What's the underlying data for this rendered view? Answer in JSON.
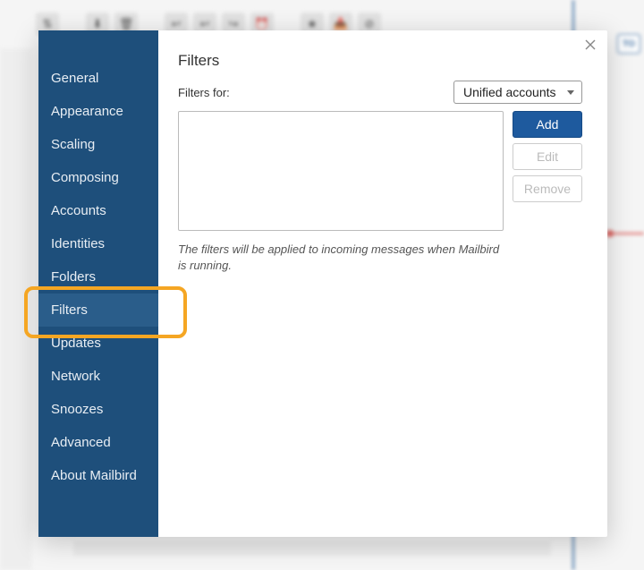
{
  "colors": {
    "sidebar_bg": "#1e4f7b",
    "sidebar_selected": "#2a5d8a",
    "primary_button": "#1e5a9e",
    "highlight": "#f5a623",
    "accent_line": "#2e639c",
    "now_indicator": "#d9534f"
  },
  "bg": {
    "today_label": "TO",
    "toolbar_icons": [
      "sort-icon",
      "download-icon",
      "delete-icon",
      "reply-icon",
      "reply-all-icon",
      "forward-icon",
      "snooze-icon",
      "star-icon",
      "archive-icon",
      "block-icon"
    ]
  },
  "modal": {
    "close_label": "Close",
    "sidebar": {
      "items": [
        {
          "label": "General"
        },
        {
          "label": "Appearance"
        },
        {
          "label": "Scaling"
        },
        {
          "label": "Composing"
        },
        {
          "label": "Accounts"
        },
        {
          "label": "Identities"
        },
        {
          "label": "Folders"
        },
        {
          "label": "Filters",
          "selected": true
        },
        {
          "label": "Updates"
        },
        {
          "label": "Network"
        },
        {
          "label": "Snoozes"
        },
        {
          "label": "Advanced"
        },
        {
          "label": "About Mailbird"
        }
      ]
    },
    "content": {
      "title": "Filters",
      "filters_for_label": "Filters for:",
      "account_selected": "Unified accounts",
      "buttons": {
        "add": "Add",
        "edit": "Edit",
        "remove": "Remove"
      },
      "note": "The filters will be applied to incoming messages when Mailbird is running."
    }
  }
}
